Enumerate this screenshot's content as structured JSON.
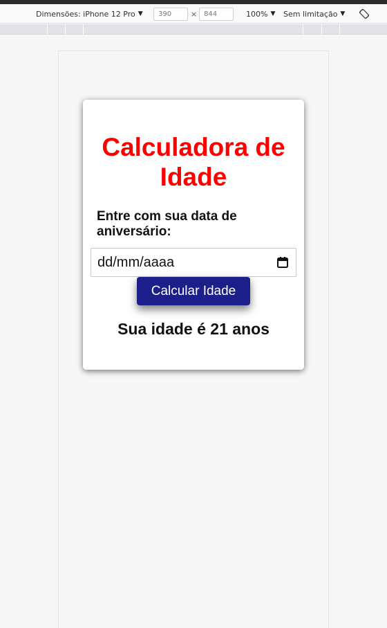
{
  "devtools": {
    "dimensions_label": "Dimensões: iPhone 12 Pro",
    "width_value": "390",
    "times_symbol": "×",
    "height_value": "844",
    "zoom_label": "100%",
    "throttle_label": "Sem limitação"
  },
  "app": {
    "title": "Calculadora de Idade",
    "date_label": "Entre com sua data de aniversário:",
    "date_placeholder": "dd/mm/aaaa",
    "button_label": "Calcular Idade",
    "result_text": "Sua idade é 21 anos"
  },
  "colors": {
    "title": "#ff0000",
    "button": "#1c1f8a",
    "button_text": "#ffffff"
  },
  "icons": {
    "calendar": "calendar-icon",
    "rotate": "rotate-device-icon",
    "caret": "caret-down-icon"
  }
}
